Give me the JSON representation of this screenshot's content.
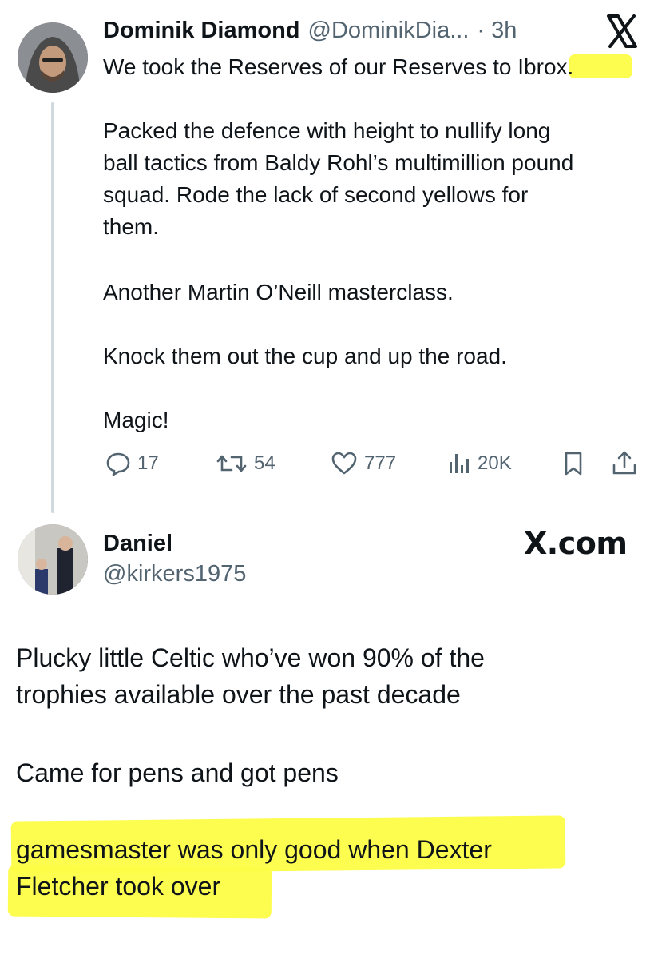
{
  "tweet1": {
    "author_name": "Dominik Diamond",
    "author_handle": "@DominikDia...",
    "time": "· 3h",
    "text_lines": [
      "We took the Reserves of our Reserves to Ibrox.",
      "Packed the defence with height to nullify long\nball tactics from Baldy Rohl’s multimillion pound\nsquad. Rode the lack of second yellows for\nthem.",
      "Another Martin O’Neill masterclass.",
      "Knock them out the cup and up the road.",
      "Magic!"
    ],
    "actions": {
      "replies": "17",
      "reposts": "54",
      "likes": "777",
      "views": "20K"
    }
  },
  "tweet2": {
    "author_name": "Daniel",
    "author_handle": "@kirkers1975",
    "brand": "X.com",
    "paragraphs": [
      "Plucky little Celtic who’ve won 90% of the\ntrophies available over the past decade",
      "Came for pens and got pens",
      "gamesmaster was only good when Dexter\nFletcher took over"
    ]
  },
  "colors": {
    "highlight": "#fdfd47",
    "muted": "#536471",
    "text": "#0f1419"
  }
}
